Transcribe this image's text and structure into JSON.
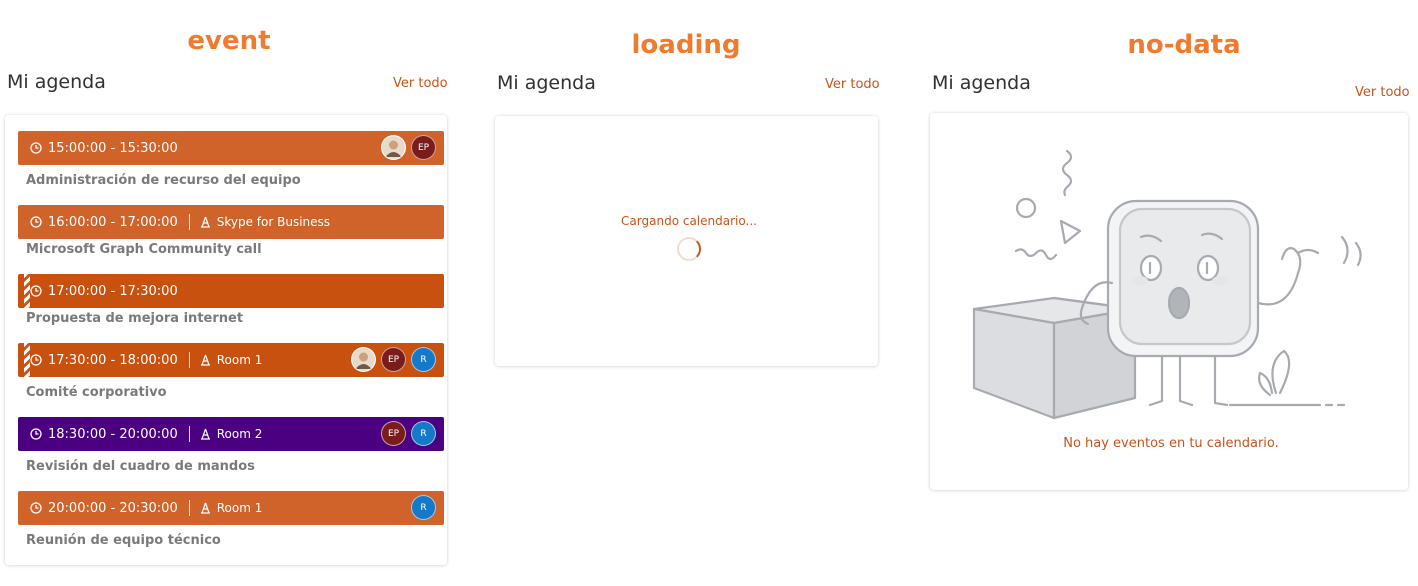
{
  "states": {
    "event": "event",
    "loading": "loading",
    "nodata": "no-data"
  },
  "agenda": {
    "title": "Mi agenda",
    "see_all": "Ver todo"
  },
  "events": [
    {
      "time": "15:00:00 - 15:30:00",
      "location": "",
      "subject": "Administración de recurso del equipo",
      "color": "#d0632a",
      "tentative": false,
      "attendees": [
        {
          "type": "photo"
        },
        {
          "initials": "EP",
          "color": "#7a1c1c"
        }
      ]
    },
    {
      "time": "16:00:00 - 17:00:00",
      "location": "Skype for Business",
      "subject": "Microsoft Graph Community call",
      "color": "#d0632a",
      "tentative": false,
      "attendees": []
    },
    {
      "time": "17:00:00 - 17:30:00",
      "location": "",
      "subject": "Propuesta de mejora internet",
      "color": "#c9510f",
      "tentative": true,
      "attendees": []
    },
    {
      "time": "17:30:00 - 18:00:00",
      "location": "Room 1",
      "subject": "Comité corporativo",
      "color": "#c9510f",
      "tentative": true,
      "attendees": [
        {
          "type": "photo"
        },
        {
          "initials": "EP",
          "color": "#7a1c1c"
        },
        {
          "initials": "R",
          "color": "#1579c9"
        }
      ]
    },
    {
      "time": "18:30:00 - 20:00:00",
      "location": "Room 2",
      "subject": "Revisión del cuadro de mandos",
      "color": "#4b0082",
      "tentative": false,
      "attendees": [
        {
          "initials": "EP",
          "color": "#7a1c1c"
        },
        {
          "initials": "R",
          "color": "#1579c9"
        }
      ]
    },
    {
      "time": "20:00:00 - 20:30:00",
      "location": "Room 1",
      "subject": "Reunión de equipo técnico",
      "color": "#d0632a",
      "tentative": false,
      "attendees": [
        {
          "initials": "R",
          "color": "#1579c9"
        }
      ]
    }
  ],
  "loading_text": "Cargando calendario...",
  "no_data_text": "No hay eventos en tu calendario.",
  "colors": {
    "accent": "#c7541c",
    "heading": "#f07b2e"
  }
}
